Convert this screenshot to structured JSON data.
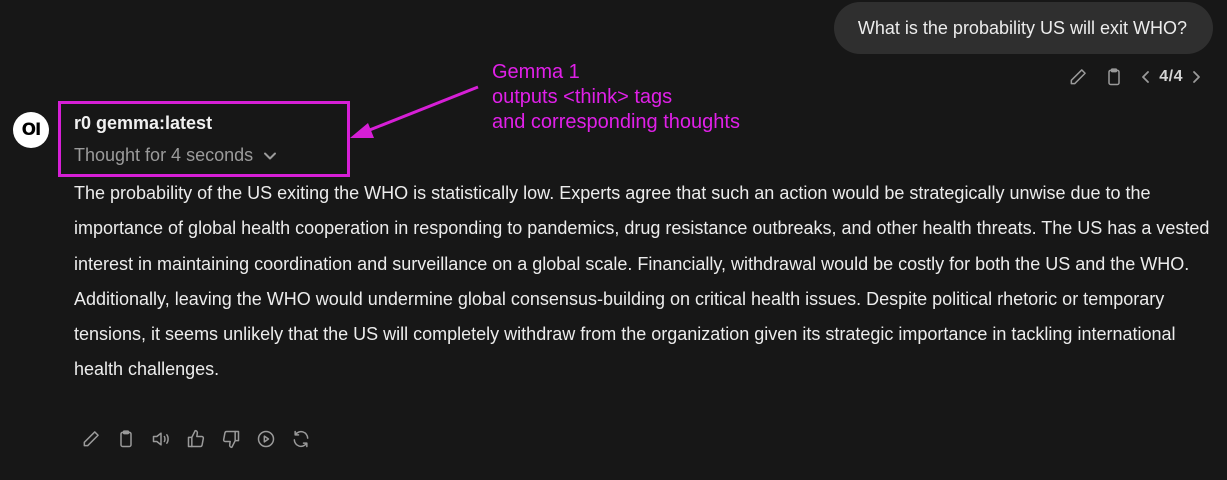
{
  "user_message": {
    "text": "What is the probability US will exit WHO?",
    "pager": "4/4",
    "actions": [
      {
        "name": "edit-icon"
      },
      {
        "name": "copy-icon"
      }
    ]
  },
  "assistant": {
    "avatar_text": "OI",
    "model_name": "r0 gemma:latest",
    "thought_label": "Thought for 4 seconds",
    "response_text": "The probability of the US exiting the WHO is statistically low. Experts agree that such an action would be strategically unwise due to the importance of global health cooperation in responding to pandemics, drug resistance outbreaks, and other health threats. The US has a vested interest in maintaining coordination and surveillance on a global scale. Financially, withdrawal would be costly for both the US and the WHO. Additionally, leaving the WHO would undermine global consensus-building on critical health issues. Despite political rhetoric or temporary tensions, it seems unlikely that the US will completely withdraw from the organization given its strategic importance in tackling international health challenges.",
    "actions": [
      {
        "name": "edit-icon"
      },
      {
        "name": "copy-icon"
      },
      {
        "name": "speaker-icon"
      },
      {
        "name": "thumbs-up-icon"
      },
      {
        "name": "thumbs-down-icon"
      },
      {
        "name": "play-circle-icon"
      },
      {
        "name": "regenerate-icon"
      }
    ]
  },
  "annotation": {
    "line1": "Gemma 1",
    "line2": "outputs <think> tags",
    "line3": "and corresponding thoughts",
    "color": "#e020e8"
  }
}
